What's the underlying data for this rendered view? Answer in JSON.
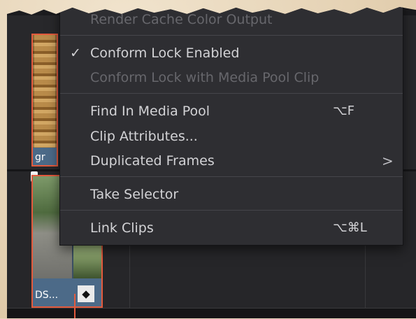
{
  "timeline": {
    "clip1_name": "gr",
    "clip2_name": "DS...",
    "clip2_marker_icon": "◆"
  },
  "menu": {
    "render_cache": "Render Cache Color Output",
    "conform_lock": "Conform Lock Enabled",
    "conform_lock_checked": "✓",
    "conform_lock_media_pool": "Conform Lock with Media Pool Clip",
    "find_in_media_pool": "Find In Media Pool",
    "find_in_media_pool_shortcut": "⌥F",
    "clip_attributes": "Clip Attributes...",
    "duplicated_frames": "Duplicated Frames",
    "submenu_arrow": ">",
    "take_selector": "Take Selector",
    "link_clips": "Link Clips",
    "link_clips_shortcut": "⌥⌘L"
  },
  "colors": {
    "accent": "#e35a3d",
    "menu_bg": "#2e2e32",
    "clip_name_bar": "#4c6a88"
  }
}
